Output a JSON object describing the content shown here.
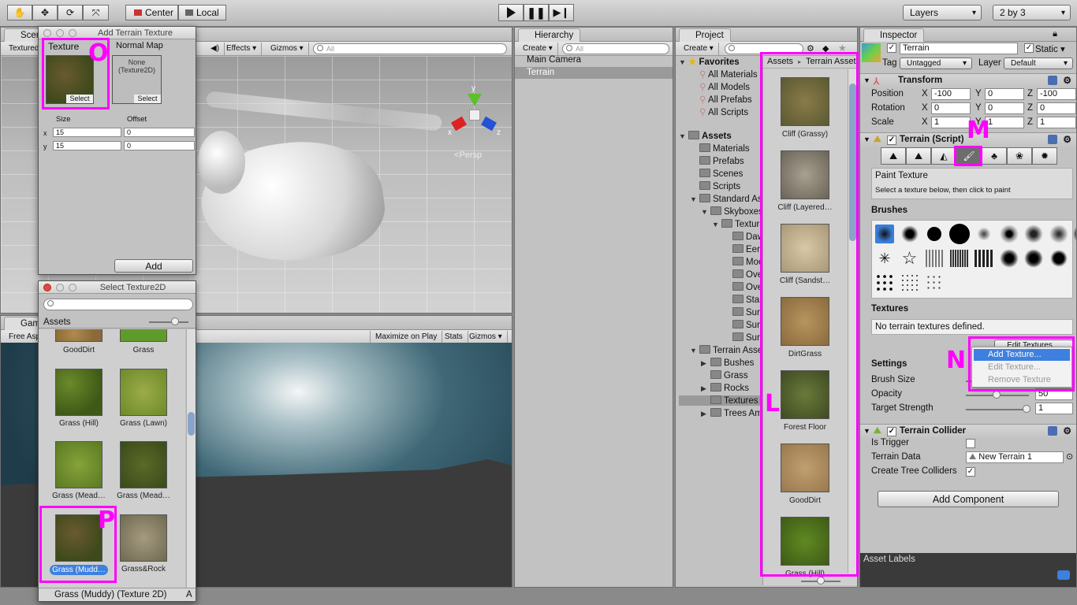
{
  "toolbar": {
    "pivot_label": "Center",
    "space_label": "Local",
    "layers_label": "Layers",
    "layout_label": "2 by 3"
  },
  "scene": {
    "tab_label": "Scene",
    "shading_mode": "Textured",
    "effects_label": "Effects",
    "gizmos_label": "Gizmos",
    "search_placeholder": "All",
    "persp_label": "Persp",
    "axis_y": "y",
    "axis_x": "x",
    "axis_z": "z"
  },
  "add_texture_window": {
    "title": "Add Terrain Texture",
    "texture_header": "Texture",
    "normal_header": "Normal Map",
    "normal_none": "None",
    "normal_type": "(Texture2D)",
    "select_label": "Select",
    "size_header": "Size",
    "offset_header": "Offset",
    "x_label": "x",
    "y_label": "y",
    "size_x": "15",
    "size_y": "15",
    "offset_x": "0",
    "offset_y": "0",
    "add_button": "Add"
  },
  "select_window": {
    "title": "Select Texture2D",
    "assets_tab": "Assets",
    "items": [
      {
        "name": "GoodDirt"
      },
      {
        "name": "Grass"
      },
      {
        "name": "Grass (Hill)"
      },
      {
        "name": "Grass (Lawn)"
      },
      {
        "name": "Grass (Mead…"
      },
      {
        "name": "Grass (Mead…"
      },
      {
        "name": "Grass (Mudd…"
      },
      {
        "name": "Grass&Rock"
      }
    ],
    "footer": "Grass (Muddy) (Texture 2D)",
    "footer_right": "A"
  },
  "game": {
    "tab_label": "Game",
    "aspect_label": "Free Aspect",
    "maximize_label": "Maximize on Play",
    "stats_label": "Stats",
    "gizmos_label": "Gizmos"
  },
  "hierarchy": {
    "tab_label": "Hierarchy",
    "create_label": "Create",
    "search_placeholder": "All",
    "items": [
      "Main Camera",
      "Terrain"
    ]
  },
  "project": {
    "tab_label": "Project",
    "create_label": "Create",
    "favorites_label": "Favorites",
    "favorites": [
      "All Materials",
      "All Models",
      "All Prefabs",
      "All Scripts"
    ],
    "assets_label": "Assets",
    "tree": [
      {
        "label": "Materials",
        "indent": 1
      },
      {
        "label": "Prefabs",
        "indent": 1
      },
      {
        "label": "Scenes",
        "indent": 1
      },
      {
        "label": "Scripts",
        "indent": 1
      },
      {
        "label": "Standard Assets",
        "indent": 1
      },
      {
        "label": "Skyboxes",
        "indent": 2
      },
      {
        "label": "Textures",
        "indent": 3
      },
      {
        "label": "Dawn",
        "indent": 4
      },
      {
        "label": "Eerie",
        "indent": 4
      },
      {
        "label": "Moon",
        "indent": 4
      },
      {
        "label": "Overcast",
        "indent": 4
      },
      {
        "label": "Overcast",
        "indent": 4
      },
      {
        "label": "StarryNight",
        "indent": 4
      },
      {
        "label": "Sunny",
        "indent": 4
      },
      {
        "label": "Sunny",
        "indent": 4
      },
      {
        "label": "Sunny",
        "indent": 4
      },
      {
        "label": "Terrain Assets",
        "indent": 1
      },
      {
        "label": "Bushes",
        "indent": 2
      },
      {
        "label": "Grass",
        "indent": 2
      },
      {
        "label": "Rocks",
        "indent": 2
      },
      {
        "label": "Textures",
        "indent": 2
      },
      {
        "label": "Trees Ambient",
        "indent": 2
      }
    ],
    "breadcrumb_root": "Assets",
    "breadcrumb_sep": "▸",
    "breadcrumb_child": "Terrain Assets",
    "textures": [
      "Cliff (Grassy)",
      "Cliff (Layered…",
      "Cliff (Sandst…",
      "DirtGrass",
      "Forest Floor",
      "GoodDirt",
      "Grass (Hill)"
    ]
  },
  "inspector": {
    "tab_label": "Inspector",
    "object_name": "Terrain",
    "static_label": "Static",
    "tag_label": "Tag",
    "tag_value": "Untagged",
    "layer_label": "Layer",
    "layer_value": "Default",
    "transform_label": "Transform",
    "position_label": "Position",
    "rotation_label": "Rotation",
    "scale_label": "Scale",
    "axis": {
      "x": "X",
      "y": "Y",
      "z": "Z"
    },
    "position": [
      "-100",
      "0",
      "-100"
    ],
    "rotation": [
      "0",
      "0",
      "0"
    ],
    "scale": [
      "1",
      "1",
      "1"
    ],
    "terrain_script_label": "Terrain (Script)",
    "paint_title": "Paint Texture",
    "paint_hint": "Select a texture below, then click to paint",
    "brushes_label": "Brushes",
    "textures_label": "Textures",
    "no_textures": "No terrain textures defined.",
    "edit_textures": "Edit Textures…",
    "menu": [
      "Add Texture...",
      "Edit Texture...",
      "Remove Texture"
    ],
    "settings_label": "Settings",
    "brush_size_label": "Brush Size",
    "opacity_label": "Opacity",
    "opacity_value": "50",
    "target_strength_label": "Target Strength",
    "target_strength_value": "1",
    "collider_label": "Terrain Collider",
    "is_trigger_label": "Is Trigger",
    "terrain_data_label": "Terrain Data",
    "terrain_data_value": "New Terrain 1",
    "create_tree_colliders_label": "Create Tree Colliders",
    "add_component": "Add Component",
    "asset_labels": "Asset Labels"
  },
  "annotations": {
    "o": "O",
    "p": "P",
    "l": "L",
    "m": "M",
    "n": "N"
  },
  "colors": {
    "highlight": "#ff00ff",
    "selection": "#3d80df"
  }
}
